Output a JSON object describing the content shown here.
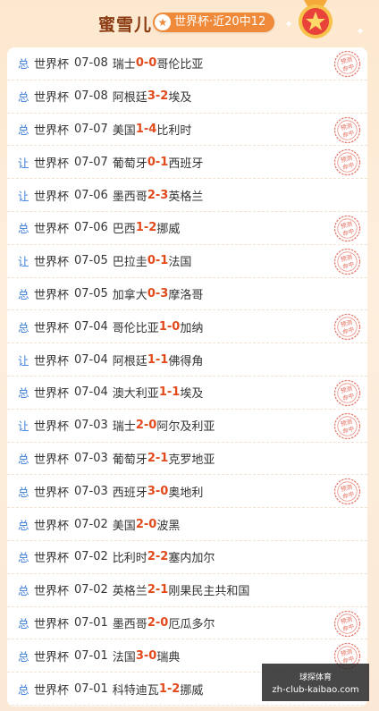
{
  "header": {
    "title": "蜜雪儿",
    "badge": "世界杯·近20中12"
  },
  "stamp_text": "预测命中",
  "colors": {
    "score": "#e24a1c",
    "type": "#3a7bd5",
    "badge": "#ee8a3a",
    "stamp": "#e26a5a"
  },
  "matches": [
    {
      "type": "总",
      "league": "世界杯",
      "date": "07-08",
      "home": "瑞士",
      "hs": "0",
      "as": "0",
      "away": "哥伦比亚",
      "hit": true
    },
    {
      "type": "总",
      "league": "世界杯",
      "date": "07-08",
      "home": "阿根廷",
      "hs": "3",
      "as": "2",
      "away": "埃及",
      "hit": false
    },
    {
      "type": "总",
      "league": "世界杯",
      "date": "07-07",
      "home": "美国",
      "hs": "1",
      "as": "4",
      "away": "比利时",
      "hit": true
    },
    {
      "type": "让",
      "league": "世界杯",
      "date": "07-07",
      "home": "葡萄牙",
      "hs": "0",
      "as": "1",
      "away": "西班牙",
      "hit": true
    },
    {
      "type": "让",
      "league": "世界杯",
      "date": "07-06",
      "home": "墨西哥",
      "hs": "2",
      "as": "3",
      "away": "英格兰",
      "hit": false
    },
    {
      "type": "总",
      "league": "世界杯",
      "date": "07-06",
      "home": "巴西",
      "hs": "1",
      "as": "2",
      "away": "挪威",
      "hit": true
    },
    {
      "type": "让",
      "league": "世界杯",
      "date": "07-05",
      "home": "巴拉圭",
      "hs": "0",
      "as": "1",
      "away": "法国",
      "hit": true
    },
    {
      "type": "总",
      "league": "世界杯",
      "date": "07-05",
      "home": "加拿大",
      "hs": "0",
      "as": "3",
      "away": "摩洛哥",
      "hit": false
    },
    {
      "type": "总",
      "league": "世界杯",
      "date": "07-04",
      "home": "哥伦比亚",
      "hs": "1",
      "as": "0",
      "away": "加纳",
      "hit": true
    },
    {
      "type": "让",
      "league": "世界杯",
      "date": "07-04",
      "home": "阿根廷",
      "hs": "1",
      "as": "1",
      "away": "佛得角",
      "hit": false
    },
    {
      "type": "总",
      "league": "世界杯",
      "date": "07-04",
      "home": "澳大利亚",
      "hs": "1",
      "as": "1",
      "away": "埃及",
      "hit": true
    },
    {
      "type": "让",
      "league": "世界杯",
      "date": "07-03",
      "home": "瑞士",
      "hs": "2",
      "as": "0",
      "away": "阿尔及利亚",
      "hit": true
    },
    {
      "type": "总",
      "league": "世界杯",
      "date": "07-03",
      "home": "葡萄牙",
      "hs": "2",
      "as": "1",
      "away": "克罗地亚",
      "hit": false
    },
    {
      "type": "总",
      "league": "世界杯",
      "date": "07-03",
      "home": "西班牙",
      "hs": "3",
      "as": "0",
      "away": "奥地利",
      "hit": true
    },
    {
      "type": "总",
      "league": "世界杯",
      "date": "07-02",
      "home": "美国",
      "hs": "2",
      "as": "0",
      "away": "波黑",
      "hit": false
    },
    {
      "type": "总",
      "league": "世界杯",
      "date": "07-02",
      "home": "比利时",
      "hs": "2",
      "as": "2",
      "away": "塞内加尔",
      "hit": false
    },
    {
      "type": "总",
      "league": "世界杯",
      "date": "07-02",
      "home": "英格兰",
      "hs": "2",
      "as": "1",
      "away": "刚果民主共和国",
      "hit": false
    },
    {
      "type": "总",
      "league": "世界杯",
      "date": "07-01",
      "home": "墨西哥",
      "hs": "2",
      "as": "0",
      "away": "厄瓜多尔",
      "hit": true
    },
    {
      "type": "总",
      "league": "世界杯",
      "date": "07-01",
      "home": "法国",
      "hs": "3",
      "as": "0",
      "away": "瑞典",
      "hit": true
    },
    {
      "type": "总",
      "league": "世界杯",
      "date": "07-01",
      "home": "科特迪瓦",
      "hs": "1",
      "as": "2",
      "away": "挪威",
      "hit": false
    }
  ],
  "watermark": {
    "line1": "球探体育",
    "line2": "zh-club-kaibao.com"
  }
}
